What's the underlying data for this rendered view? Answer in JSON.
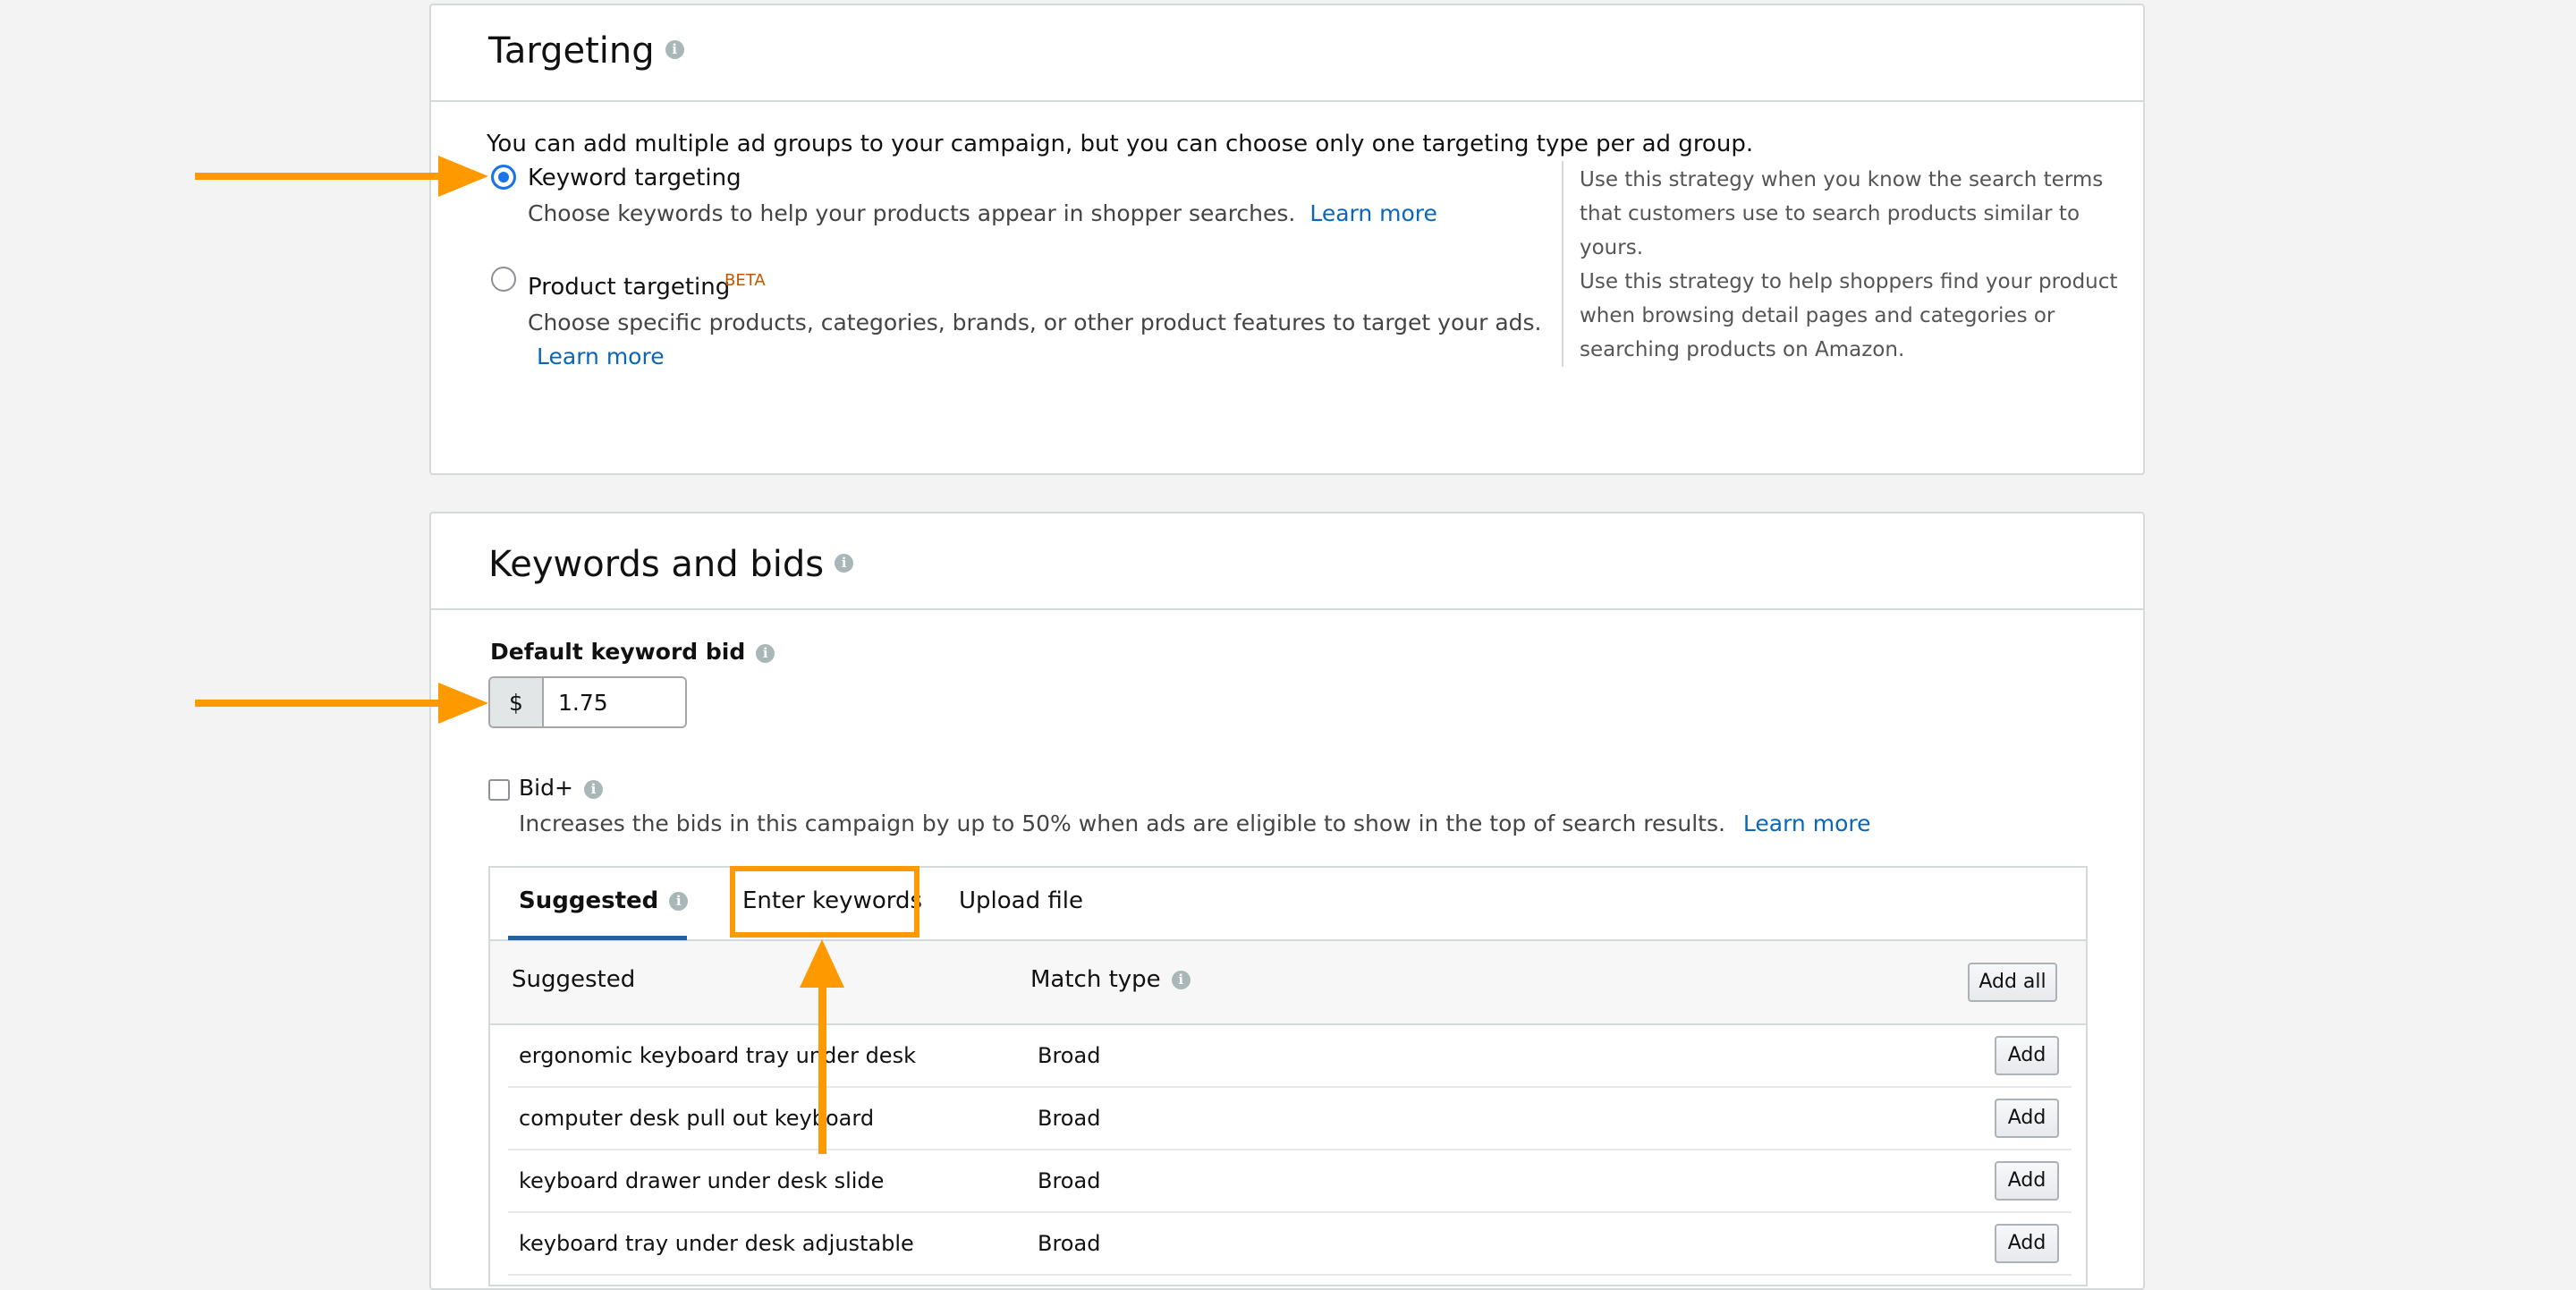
{
  "targeting": {
    "title": "Targeting",
    "intro": "You can add multiple ad groups to your campaign, but you can choose only one targeting type per ad group.",
    "options": [
      {
        "label": "Keyword targeting",
        "selected": true,
        "description": "Choose keywords to help your products appear in shopper searches.",
        "learn_more": "Learn more"
      },
      {
        "label": "Product targeting",
        "badge": "BETA",
        "selected": false,
        "description": "Choose specific products, categories, brands, or other product features to target your ads.",
        "learn_more": "Learn more"
      }
    ],
    "hints": [
      "Use this strategy when you know the search terms",
      "that customers use to search products similar to",
      "yours.",
      "Use this strategy to help shoppers find your product",
      "when browsing detail pages and categories or",
      "searching products on Amazon."
    ]
  },
  "keywords": {
    "title": "Keywords and bids",
    "default_bid_label": "Default keyword bid",
    "currency": "$",
    "default_bid_value": "1.75",
    "bidplus": {
      "label": "Bid+",
      "checked": false,
      "description": "Increases the bids in this campaign by up to 50% when ads are eligible to show in the top of search results.",
      "learn_more": "Learn more"
    },
    "tabs": [
      "Suggested",
      "Enter keywords",
      "Upload file"
    ],
    "active_tab": "Suggested",
    "table": {
      "col_keyword": "Suggested",
      "col_match": "Match type",
      "add_all": "Add all",
      "rows": [
        {
          "keyword": "ergonomic keyboard tray under desk",
          "match": "Broad",
          "action": "Add"
        },
        {
          "keyword": "computer desk pull out keyboard",
          "match": "Broad",
          "action": "Add"
        },
        {
          "keyword": "keyboard drawer under desk slide",
          "match": "Broad",
          "action": "Add"
        },
        {
          "keyword": "keyboard tray under desk adjustable",
          "match": "Broad",
          "action": "Add"
        }
      ]
    }
  },
  "colors": {
    "annotation_orange": "#ff9900",
    "link_blue": "#0a66b7",
    "radio_blue": "#1a73e8",
    "tab_underline": "#2162a1"
  }
}
